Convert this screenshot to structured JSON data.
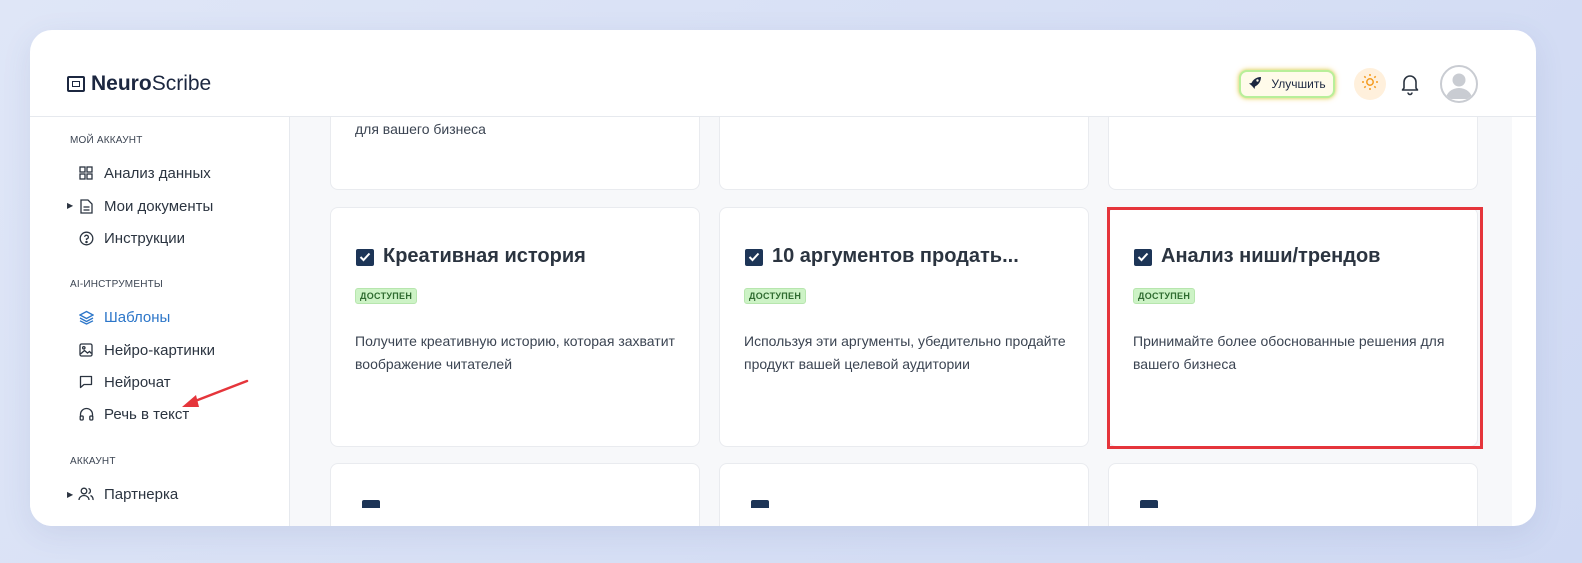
{
  "header": {
    "logo_bold": "Neuro",
    "logo_regular": "Scribe",
    "upgrade_label": "Улучшить"
  },
  "sidebar": {
    "section_account": "МОЙ АККАУНТ",
    "item_analysis": "Анализ данных",
    "item_documents": "Мои документы",
    "item_instructions": "Инструкции",
    "section_ai": "AI-ИНСТРУМЕНТЫ",
    "item_templates": "Шаблоны",
    "item_images": "Нейро-картинки",
    "item_chat": "Нейрочат",
    "item_speech": "Речь в текст",
    "section_account2": "АККАУНТ",
    "item_partner": "Партнерка"
  },
  "cards": {
    "top_left_desc": "для вашего бизнеса",
    "card1": {
      "title": "Креативная история",
      "badge": "ДОСТУПЕН",
      "desc": "Получите креативную историю, которая захватит воображение читателей"
    },
    "card2": {
      "title": "10 аргументов продать...",
      "badge": "ДОСТУПЕН",
      "desc": "Используя эти аргументы, убедительно продайте продукт вашей целевой аудитории"
    },
    "card3": {
      "title": "Анализ ниши/трендов",
      "badge": "ДОСТУПЕН",
      "desc": "Принимайте более обоснованные решения для вашего бизнеса"
    }
  },
  "colors": {
    "accent": "#2c76c9",
    "highlight": "#e5353b",
    "badge_bg": "#cdf3c6"
  }
}
